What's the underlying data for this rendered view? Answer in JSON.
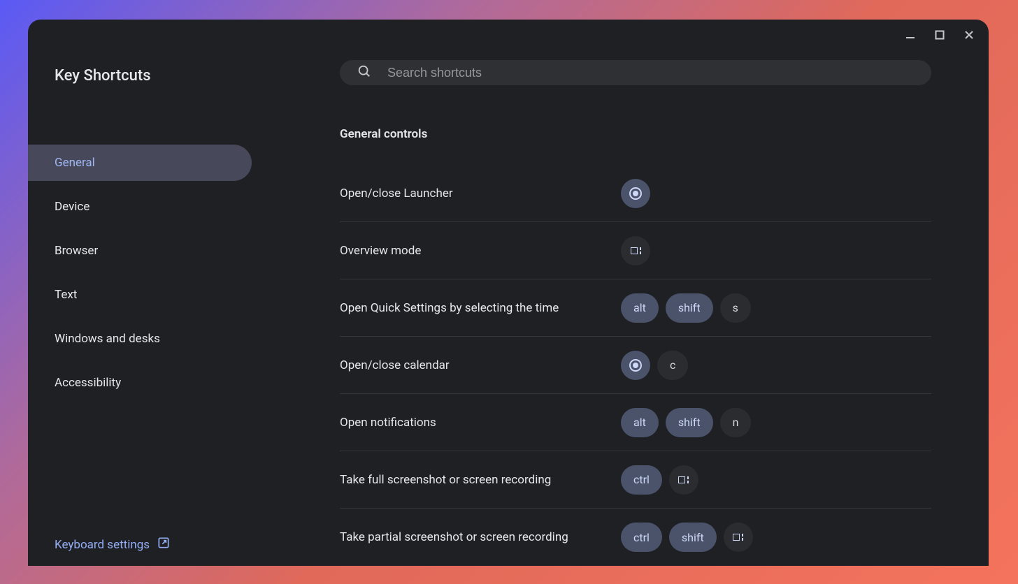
{
  "app_title": "Key Shortcuts",
  "search": {
    "placeholder": "Search shortcuts"
  },
  "sidebar": {
    "items": [
      {
        "label": "General",
        "active": true
      },
      {
        "label": "Device",
        "active": false
      },
      {
        "label": "Browser",
        "active": false
      },
      {
        "label": "Text",
        "active": false
      },
      {
        "label": "Windows and desks",
        "active": false
      },
      {
        "label": "Accessibility",
        "active": false
      }
    ],
    "footer_link": "Keyboard settings"
  },
  "section_title": "General controls",
  "shortcuts": [
    {
      "label": "Open/close Launcher",
      "keys": [
        {
          "type": "icon",
          "icon": "launcher",
          "style": "mod"
        }
      ]
    },
    {
      "label": "Overview mode",
      "keys": [
        {
          "type": "icon",
          "icon": "overview",
          "style": "dark"
        }
      ]
    },
    {
      "label": "Open Quick Settings by selecting the time",
      "keys": [
        {
          "type": "text",
          "text": "alt",
          "style": "mod"
        },
        {
          "type": "text",
          "text": "shift",
          "style": "mod"
        },
        {
          "type": "text",
          "text": "s",
          "style": "dark"
        }
      ]
    },
    {
      "label": "Open/close calendar",
      "keys": [
        {
          "type": "icon",
          "icon": "launcher",
          "style": "mod"
        },
        {
          "type": "text",
          "text": "c",
          "style": "dark"
        }
      ]
    },
    {
      "label": "Open notifications",
      "keys": [
        {
          "type": "text",
          "text": "alt",
          "style": "mod"
        },
        {
          "type": "text",
          "text": "shift",
          "style": "mod"
        },
        {
          "type": "text",
          "text": "n",
          "style": "dark"
        }
      ]
    },
    {
      "label": "Take full screenshot or screen recording",
      "keys": [
        {
          "type": "text",
          "text": "ctrl",
          "style": "mod"
        },
        {
          "type": "icon",
          "icon": "overview",
          "style": "dark"
        }
      ]
    },
    {
      "label": "Take partial screenshot or screen recording",
      "keys": [
        {
          "type": "text",
          "text": "ctrl",
          "style": "mod"
        },
        {
          "type": "text",
          "text": "shift",
          "style": "mod"
        },
        {
          "type": "icon",
          "icon": "overview",
          "style": "dark"
        }
      ]
    }
  ]
}
